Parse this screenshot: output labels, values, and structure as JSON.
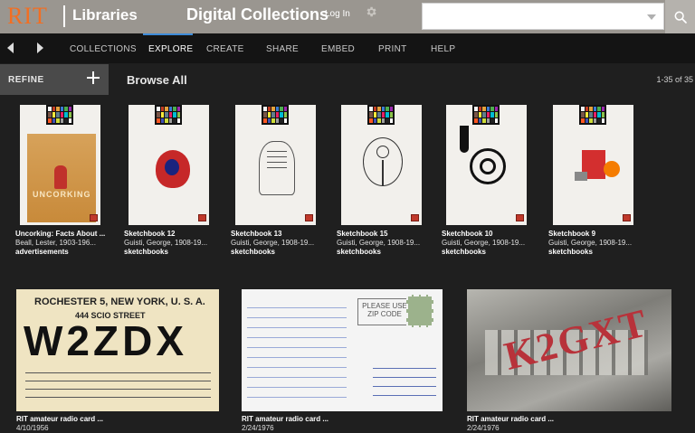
{
  "header": {
    "logo_rit": "RIT",
    "logo_libraries": "Libraries",
    "site_title": "Digital Collections",
    "login": "Log In",
    "search_placeholder": ""
  },
  "nav": {
    "items": [
      "COLLECTIONS",
      "EXPLORE",
      "CREATE",
      "SHARE",
      "EMBED",
      "PRINT",
      "HELP"
    ],
    "active": "EXPLORE"
  },
  "refine": {
    "label": "REFINE"
  },
  "browse": {
    "title": "Browse All",
    "count": "1-35 of 35"
  },
  "row1": [
    {
      "title": "Uncorking: Facts About ...",
      "creator": "Beall, Lester, 1903-196...",
      "type": "advertisements"
    },
    {
      "title": "Sketchbook 12",
      "creator": "Guisti, George, 1908-19...",
      "type": "sketchbooks"
    },
    {
      "title": "Sketchbook 13",
      "creator": "Guisti, George, 1908-19...",
      "type": "sketchbooks"
    },
    {
      "title": "Sketchbook 15",
      "creator": "Guisti, George, 1908-19...",
      "type": "sketchbooks"
    },
    {
      "title": "Sketchbook 10",
      "creator": "Guisti, George, 1908-19...",
      "type": "sketchbooks"
    },
    {
      "title": "Sketchbook 9",
      "creator": "Guisti, George, 1908-19...",
      "type": "sketchbooks"
    }
  ],
  "row2": [
    {
      "title": "RIT amateur radio card ...",
      "date": "4/10/1956"
    },
    {
      "title": "RIT amateur radio card ...",
      "date": "2/24/1976"
    },
    {
      "title": "RIT amateur radio card ...",
      "date": "2/24/1976"
    }
  ],
  "qsl1": {
    "line1": "ROCHESTER 5, NEW YORK, U. S. A.",
    "line2": "444 SCIO STREET",
    "callsign": "W2ZDX"
  },
  "qsl2": {
    "line1": "PLEASE USE",
    "line2": "ZIP CODE"
  },
  "qsl3": {
    "callsign": "K2GXT"
  },
  "colors": {
    "accent": "#3d8bd8",
    "brand_orange": "#f36e21",
    "header_bg": "#9a9690",
    "page_bg": "#1f1f1f"
  }
}
